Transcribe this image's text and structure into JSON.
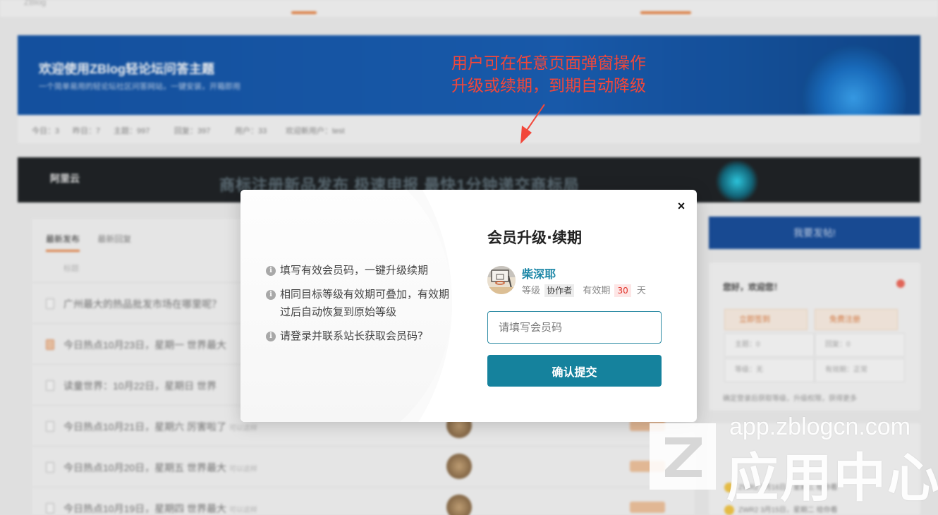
{
  "background": {
    "site_name": "ZBlog",
    "hero": {
      "title": "欢迎使用ZBlog轻论坛问答主题",
      "subtitle": "一个简单易用的轻论坛社区问答网站，一键安装，开箱即用"
    },
    "stats": [
      "今日：3",
      "昨日：7",
      "主题：997",
      "回复：397",
      "用户：33",
      "欢迎新用户：test"
    ],
    "ad": {
      "logo": "阿里云",
      "text": "商标注册新品发布  极速申报  最快1分钟递交商标局"
    },
    "feed": {
      "tabs": [
        "最新发布",
        "最新回复"
      ],
      "header": "标题",
      "rows": [
        {
          "title": "广州最大的热品批发市场在哪里呢？",
          "hot": false
        },
        {
          "title": "今日热点10月23日，星期一 世界最大",
          "hot": true
        },
        {
          "title": "读童世界：10月22日，星期日 世界",
          "hot": false
        },
        {
          "title": "今日热点10月21日，星期六 厉害啦了",
          "tag": "可以这样",
          "hot": false
        },
        {
          "title": "今日热点10月20日，星期五 世界最大",
          "tag": "可以这样",
          "hot": false
        },
        {
          "title": "今日热点10月19日，星期四 世界最大",
          "tag": "可以这样",
          "hot": false
        }
      ]
    },
    "sidebar": {
      "post_button": "我要发帖!",
      "card_title": "您好，欢迎您！",
      "btn_checkin": "立即签到",
      "btn_register": "免费注册",
      "cells": [
        "主题：0",
        "回复：0",
        "等级：无",
        "有效期：正常"
      ],
      "note": "确定登录后获取等级，升级权限，获得更多",
      "list": [
        "ZWR2 3月16日，星期三 给你看",
        "ZWR2 3月15日，星期二 给你看"
      ]
    }
  },
  "annotation": {
    "lines": [
      "用户可在任意页面弹窗操作",
      "升级或续期，到期自动降级"
    ],
    "color": "#f2473a"
  },
  "modal": {
    "close_label": "×",
    "title": "会员升级·续期",
    "tips": [
      "填写有效会员码，一键升级续期",
      "相同目标等级有效期可叠加，有效期过后自动恢复到原始等级",
      "请登录并联系站长获取会员码?"
    ],
    "info_glyph": "i",
    "user": {
      "name": "柴深耶",
      "level_label": "等级",
      "level": "协作者",
      "validity_label": "有效期",
      "days": "30",
      "days_unit": "天"
    },
    "input_placeholder": "请填写会员码",
    "submit_label": "确认提交",
    "accent": "#15829d"
  },
  "watermark": {
    "logo_letter": "Z",
    "url": "app.zblogcn.com",
    "name": "应用中心"
  }
}
